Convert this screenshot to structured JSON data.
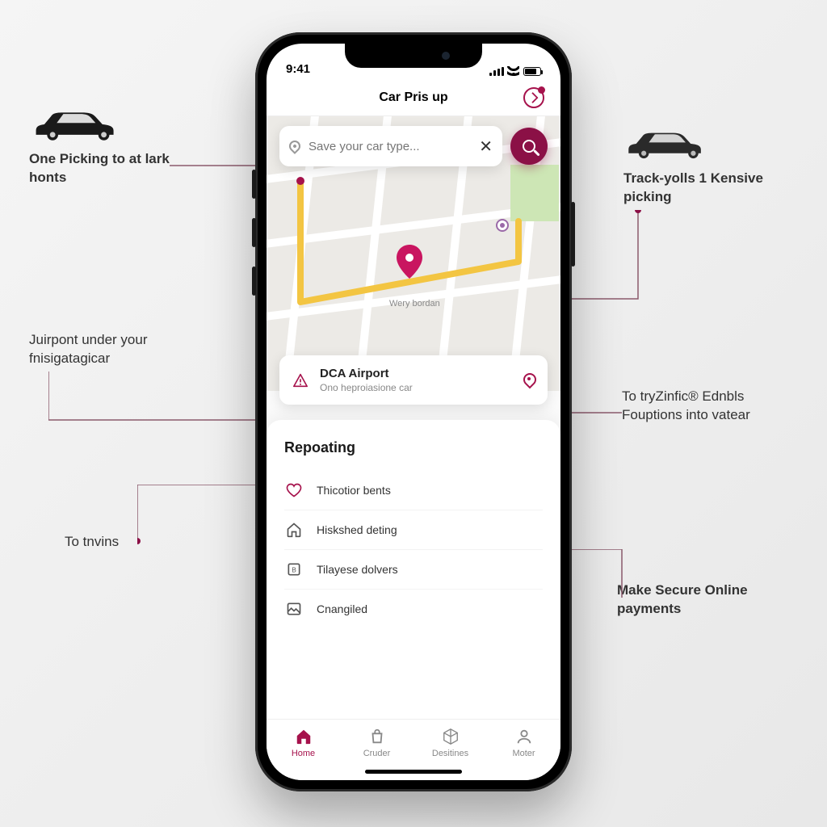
{
  "statusbar": {
    "time": "9:41"
  },
  "header": {
    "title": "Car Pris up"
  },
  "search": {
    "placeholder": "Save your car type..."
  },
  "map": {
    "label": "Wery bordan"
  },
  "location_card": {
    "title": "DCA Airport",
    "subtitle": "Ono heproiasione car"
  },
  "panel": {
    "heading": "Repoating",
    "features": [
      {
        "icon": "heart-icon",
        "label": "Thicotior bents",
        "accent": true
      },
      {
        "icon": "home-icon",
        "label": "Hiskshed deting"
      },
      {
        "icon": "box-icon",
        "label": "Tilayese dolvers"
      },
      {
        "icon": "picture-icon",
        "label": "Cnangiled"
      }
    ]
  },
  "nav": {
    "items": [
      {
        "icon": "home-filled-icon",
        "label": "Home",
        "active": true
      },
      {
        "icon": "bag-icon",
        "label": "Cruder"
      },
      {
        "icon": "cube-icon",
        "label": "Desitines"
      },
      {
        "icon": "user-icon",
        "label": "Moter"
      }
    ]
  },
  "callouts": {
    "top_left": "One Picking to at lark honts",
    "mid_left": "Juirpont under your fnisigatagicar",
    "low_left": "To tnvins",
    "top_right": "Track-yolls 1 Kensive picking",
    "mid_right": "To tryZinfic® Ednbls Fouptions into vatear",
    "low_right": "Make Secure Online payments"
  },
  "colors": {
    "accent": "#8b1046"
  }
}
